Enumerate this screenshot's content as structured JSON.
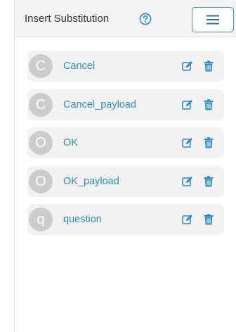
{
  "header": {
    "title": "Insert Substitution",
    "help_icon": "question-circle-icon",
    "menu_icon": "hamburger-menu-icon"
  },
  "substitutions": [
    {
      "initial": "C",
      "label": "Cancel"
    },
    {
      "initial": "C",
      "label": "Cancel_payload"
    },
    {
      "initial": "O",
      "label": "OK"
    },
    {
      "initial": "O",
      "label": "OK_payload"
    },
    {
      "initial": "q",
      "label": "question"
    }
  ],
  "icons": {
    "edit": "edit-icon",
    "delete": "trash-icon"
  },
  "colors": {
    "accent": "#2a8dc5",
    "avatar_bg": "#cccccc",
    "item_bg": "#f2f2f2",
    "header_bg": "#f4f4f4"
  }
}
